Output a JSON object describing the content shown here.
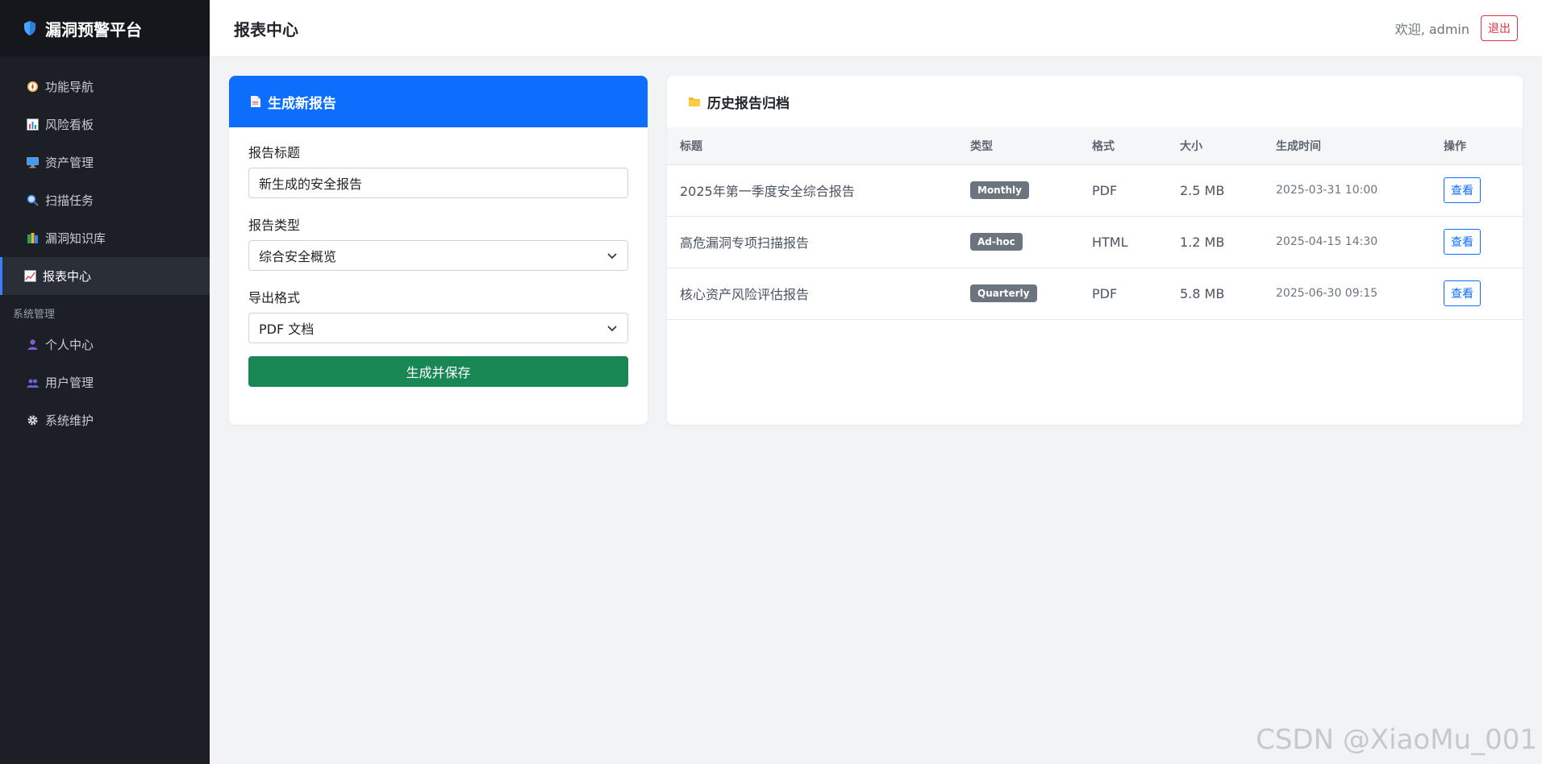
{
  "sidebar": {
    "brand": "漏洞预警平台",
    "items": [
      {
        "label": "功能导航",
        "icon": "compass-icon"
      },
      {
        "label": "风险看板",
        "icon": "bar-chart-icon"
      },
      {
        "label": "资产管理",
        "icon": "monitor-icon"
      },
      {
        "label": "扫描任务",
        "icon": "magnifier-icon"
      },
      {
        "label": "漏洞知识库",
        "icon": "books-icon"
      },
      {
        "label": "报表中心",
        "icon": "line-chart-icon",
        "active": true
      }
    ],
    "section": "系统管理",
    "sys_items": [
      {
        "label": "个人中心",
        "icon": "user-icon"
      },
      {
        "label": "用户管理",
        "icon": "users-icon"
      },
      {
        "label": "系统维护",
        "icon": "gear-icon"
      }
    ]
  },
  "header": {
    "title": "报表中心",
    "welcome": "欢迎, admin",
    "logout": "退出"
  },
  "generate": {
    "title": "生成新报告",
    "title_label": "报告标题",
    "title_value": "新生成的安全报告",
    "type_label": "报告类型",
    "type_value": "综合安全概览",
    "format_label": "导出格式",
    "format_value": "PDF 文档",
    "submit": "生成并保存"
  },
  "history": {
    "title": "历史报告归档",
    "columns": [
      "标题",
      "类型",
      "格式",
      "大小",
      "生成时间",
      "操作"
    ],
    "rows": [
      {
        "title": "2025年第一季度安全综合报告",
        "type": "Monthly",
        "format": "PDF",
        "size": "2.5 MB",
        "time": "2025-03-31 10:00",
        "action": "查看"
      },
      {
        "title": "高危漏洞专项扫描报告",
        "type": "Ad-hoc",
        "format": "HTML",
        "size": "1.2 MB",
        "time": "2025-04-15 14:30",
        "action": "查看"
      },
      {
        "title": "核心资产风险评估报告",
        "type": "Quarterly",
        "format": "PDF",
        "size": "5.8 MB",
        "time": "2025-06-30 09:15",
        "action": "查看"
      }
    ]
  },
  "watermark": "CSDN @XiaoMu_001",
  "colors": {
    "sidebar_bg": "#1c1f26",
    "primary": "#0d6efd",
    "success": "#198754",
    "danger": "#dc3545",
    "badge": "#6c757d"
  }
}
